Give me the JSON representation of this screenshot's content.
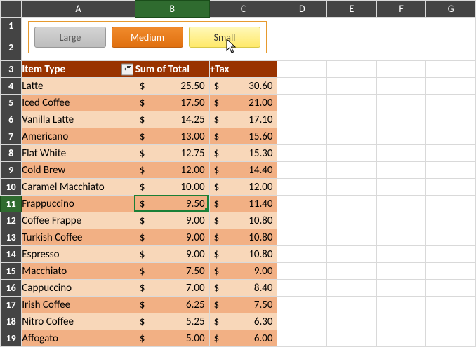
{
  "columns": [
    "A",
    "B",
    "C",
    "D",
    "E",
    "F",
    "G"
  ],
  "slicer": {
    "buttons": [
      {
        "label": "Large",
        "state": "inactive"
      },
      {
        "label": "Medium",
        "state": "active"
      },
      {
        "label": "Small",
        "state": "hover"
      }
    ]
  },
  "pivot": {
    "headers": {
      "itemType": "Item Type",
      "sumOfTotal": "Sum of Total",
      "plusTax": "+Tax"
    },
    "rows": [
      {
        "num": 4,
        "name": "Latte",
        "total": "25.50",
        "tax": "30.60",
        "band": "light"
      },
      {
        "num": 5,
        "name": "Iced Coffee",
        "total": "17.50",
        "tax": "21.00",
        "band": "dark"
      },
      {
        "num": 6,
        "name": "Vanilla Latte",
        "total": "14.25",
        "tax": "17.10",
        "band": "light"
      },
      {
        "num": 7,
        "name": "Americano",
        "total": "13.00",
        "tax": "15.60",
        "band": "dark"
      },
      {
        "num": 8,
        "name": "Flat White",
        "total": "12.75",
        "tax": "15.30",
        "band": "light"
      },
      {
        "num": 9,
        "name": "Cold Brew",
        "total": "12.00",
        "tax": "14.40",
        "band": "dark"
      },
      {
        "num": 10,
        "name": "Caramel Macchiato",
        "total": "10.00",
        "tax": "12.00",
        "band": "light"
      },
      {
        "num": 11,
        "name": "Frappuccino",
        "total": "9.50",
        "tax": "11.40",
        "band": "dark",
        "active": true
      },
      {
        "num": 12,
        "name": "Coffee Frappe",
        "total": "9.00",
        "tax": "10.80",
        "band": "light"
      },
      {
        "num": 13,
        "name": "Turkish Coffee",
        "total": "9.00",
        "tax": "10.80",
        "band": "dark"
      },
      {
        "num": 14,
        "name": "Espresso",
        "total": "9.00",
        "tax": "10.80",
        "band": "light"
      },
      {
        "num": 15,
        "name": "Macchiato",
        "total": "7.50",
        "tax": "9.00",
        "band": "dark"
      },
      {
        "num": 16,
        "name": "Cappuccino",
        "total": "7.00",
        "tax": "8.40",
        "band": "light"
      },
      {
        "num": 17,
        "name": "Irish Coffee",
        "total": "6.25",
        "tax": "7.50",
        "band": "dark"
      },
      {
        "num": 18,
        "name": "Nitro Coffee",
        "total": "5.25",
        "tax": "6.30",
        "band": "light"
      },
      {
        "num": 19,
        "name": "Affogato",
        "total": "5.00",
        "tax": "6.00",
        "band": "dark"
      }
    ]
  },
  "currency": "$",
  "rows12": [
    "1",
    "2"
  ],
  "selectedColumn": "B",
  "activeRowNum": 11
}
